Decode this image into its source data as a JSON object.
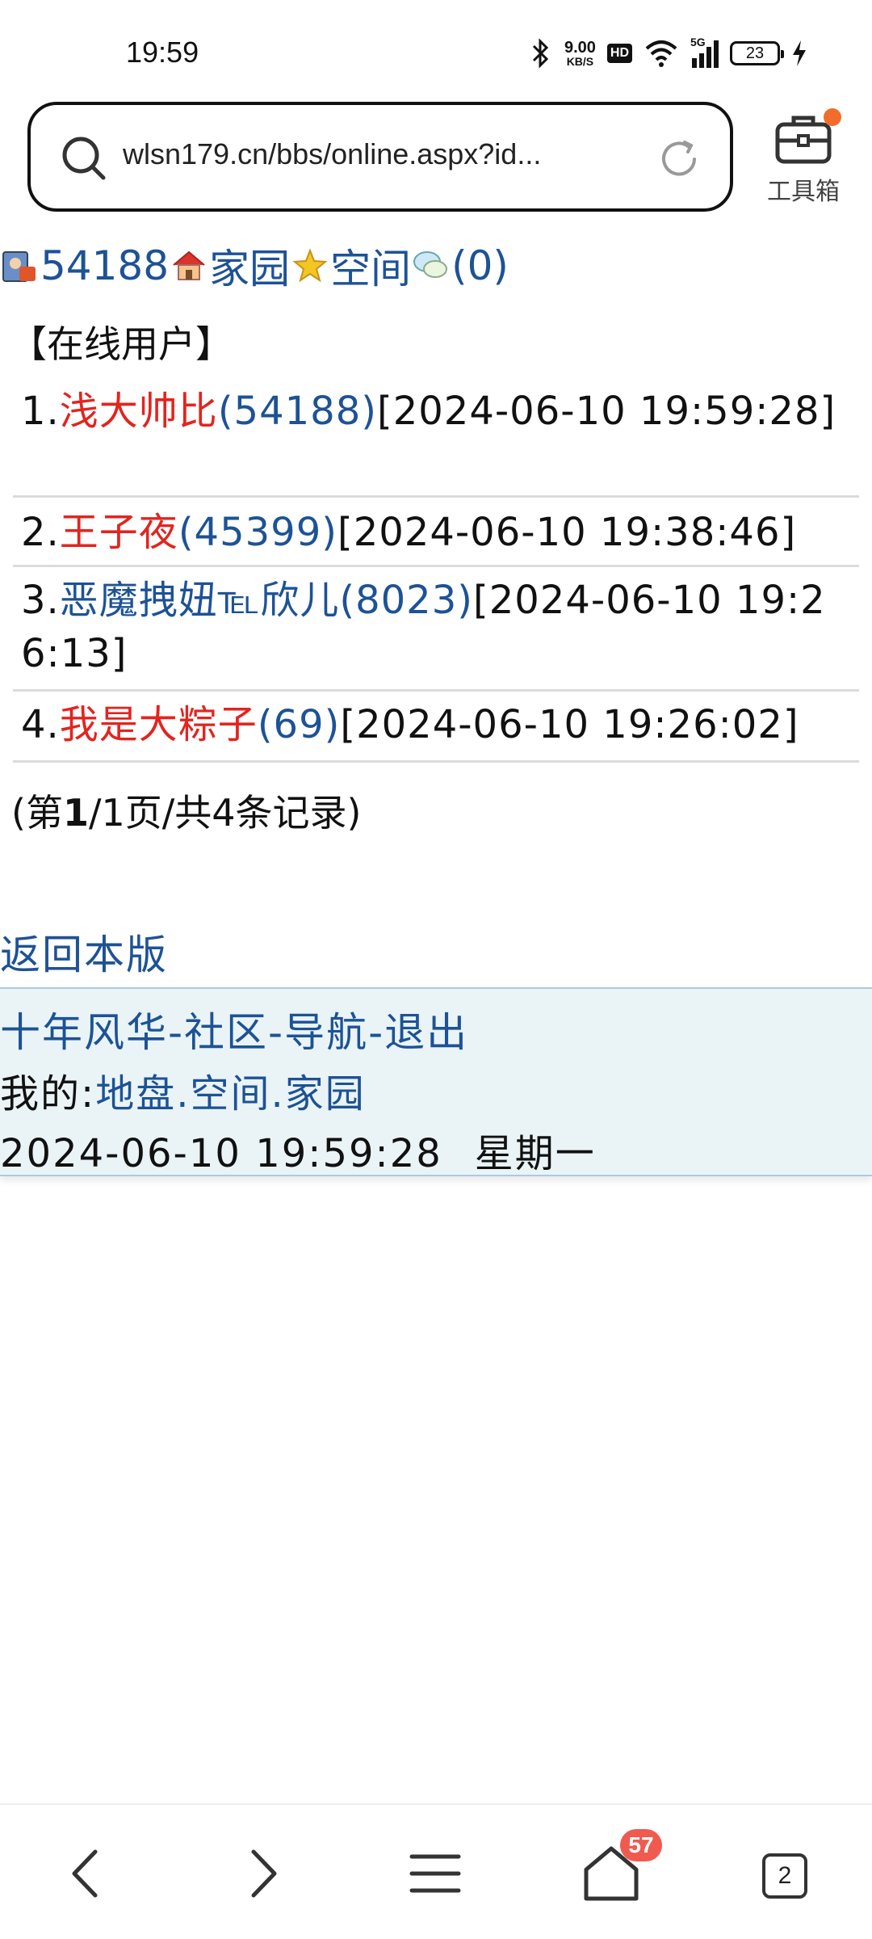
{
  "status_bar": {
    "time": "19:59",
    "net_speed_value": "9.00",
    "net_speed_unit": "KB/S",
    "hd_label": "HD",
    "network_label": "5G",
    "battery_level": "23",
    "icons": [
      "bluetooth-icon",
      "wifi-icon",
      "signal-icon",
      "battery-icon",
      "charging-icon"
    ]
  },
  "browser": {
    "url": "wlsn179.cn/bbs/online.aspx?id...",
    "toolbox_label": "工具箱",
    "tabs_count": "2",
    "home_badge": "57",
    "accent_dot_color": "#f26d2b"
  },
  "user_line": {
    "id": "54188",
    "home": "家园",
    "space": "空间",
    "messages": "(0)"
  },
  "section_title": "【在线用户】",
  "online_users": [
    {
      "index": "1.",
      "name": "浅大帅比",
      "uid": "(54188)",
      "time": "[2024-06-10 19:59:28]"
    },
    {
      "index": "2.",
      "name": "王子夜",
      "uid": "(45399)",
      "time": "[2024-06-10 19:38:46]"
    },
    {
      "index": "3.",
      "name": "恶魔拽妞℡欣儿",
      "uid": "(8023)",
      "time": "[2024-06-10 19:26:13]"
    },
    {
      "index": "4.",
      "name": "我是大粽子",
      "uid": "(69)",
      "time": "[2024-06-10 19:26:02]"
    }
  ],
  "pager": {
    "prefix": "(第",
    "current": "1",
    "rest": "/1页/共4条记录)"
  },
  "back_link": "返回本版",
  "footer": {
    "links": [
      "十年风华",
      "社区",
      "导航",
      "退出"
    ],
    "my_label": "我的:",
    "my_links": [
      "地盘",
      "空间",
      "家园"
    ],
    "datetime": "2024-06-10 19:59:28",
    "weekday": "星期一"
  },
  "colors": {
    "link_blue": "#1d5296",
    "name_red": "#e3241f",
    "footer_bg": "#eaf4f6",
    "badge_red": "#f05a4f"
  }
}
